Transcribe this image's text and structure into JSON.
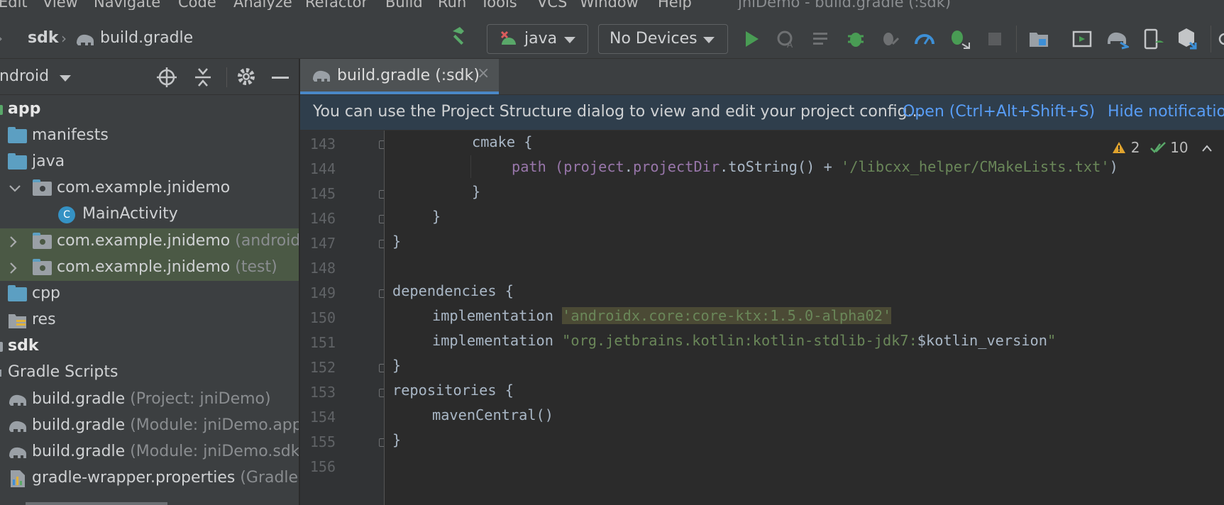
{
  "menu": {
    "items": [
      "Edit",
      "View",
      "Navigate",
      "Code",
      "Analyze",
      "Refactor",
      "Build",
      "Run",
      "Tools",
      "VCS",
      "Window",
      "Help"
    ],
    "window_title": "jniDemo - build.gradle (:sdk)"
  },
  "breadcrumb": {
    "items": [
      "sdk",
      "build.gradle"
    ]
  },
  "toolbar": {
    "run_config": "java",
    "device": "No Devices"
  },
  "project": {
    "view_mode": "Android",
    "tree": [
      {
        "label": "app",
        "hint": ""
      },
      {
        "label": "manifests",
        "hint": ""
      },
      {
        "label": "java",
        "hint": ""
      },
      {
        "label": "com.example.jnidemo",
        "hint": ""
      },
      {
        "label": "MainActivity",
        "hint": ""
      },
      {
        "label": "com.example.jnidemo",
        "hint": "(androidTest)"
      },
      {
        "label": "com.example.jnidemo",
        "hint": "(test)"
      },
      {
        "label": "cpp",
        "hint": ""
      },
      {
        "label": "res",
        "hint": ""
      },
      {
        "label": "sdk",
        "hint": ""
      },
      {
        "label": "Gradle Scripts",
        "hint": ""
      },
      {
        "label": "build.gradle",
        "hint": "(Project: jniDemo)"
      },
      {
        "label": "build.gradle",
        "hint": "(Module: jniDemo.app)"
      },
      {
        "label": "build.gradle",
        "hint": "(Module: jniDemo.sdk)"
      },
      {
        "label": "gradle-wrapper.properties",
        "hint": "(Gradle Version)"
      }
    ]
  },
  "editor": {
    "tab_label": "build.gradle (:sdk)",
    "notification": {
      "message": "You can use the Project Structure dialog to view and edit your project config...",
      "open_link": "Open (Ctrl+Alt+Shift+S)",
      "hide_link": "Hide notification"
    },
    "inspections": {
      "warnings": "2",
      "ok": "10"
    },
    "line_numbers": [
      "143",
      "144",
      "145",
      "146",
      "147",
      "148",
      "149",
      "150",
      "151",
      "152",
      "153",
      "154",
      "155",
      "156"
    ],
    "code": {
      "l143": "cmake {",
      "l144_a": "path (",
      "l144_b": "project",
      "l144_c": ".",
      "l144_d": "projectDir",
      "l144_e": ".toString() + ",
      "l144_f": "'/libcxx_helper/CMakeLists.txt'",
      "l144_g": ")",
      "l145": "}",
      "l146": "}",
      "l147": "}",
      "l149": "dependencies {",
      "l150_a": "implementation ",
      "l150_b": "'androidx.core:core-ktx:1.5.0-alpha02'",
      "l151_a": "implementation ",
      "l151_b": "\"org.jetbrains.kotlin:kotlin-stdlib-jdk7:",
      "l151_c": "$kotlin_version",
      "l151_d": "\"",
      "l152": "}",
      "l153": "repositories {",
      "l154": "mavenCentral()",
      "l155": "}"
    }
  }
}
